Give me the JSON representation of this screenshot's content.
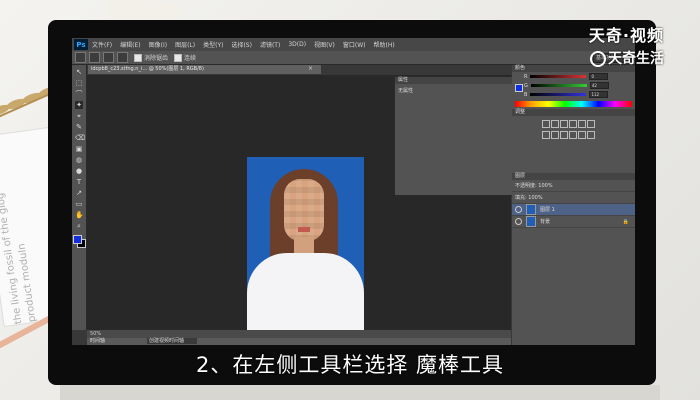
{
  "watermark": {
    "top": "天奇·视频",
    "bottom": "天奇生活"
  },
  "background_text": {
    "book": "the living fossil of the glog\nproduct moduln"
  },
  "photoshop": {
    "logo": "Ps",
    "menu": [
      "文件(F)",
      "编辑(E)",
      "图像(I)",
      "图层(L)",
      "类型(Y)",
      "选择(S)",
      "滤镜(T)",
      "3D(D)",
      "视图(V)",
      "窗口(W)",
      "帮助(H)"
    ],
    "options": {
      "checkbox_1": "消除锯齿",
      "checkbox_2": "连续",
      "right_select": "基本功能"
    },
    "document_tab": "idcpb8_c23.stfng.n_i... @ 50%(图层 1, RGB/8)",
    "tab_close": "×",
    "tools": [
      "↖",
      "⬚",
      "⌒",
      "✦",
      "⌖",
      "✎",
      "⌫",
      "▣",
      "◍",
      "●",
      "T",
      "↗",
      "▭",
      "✋",
      "⌕"
    ],
    "status": "50%",
    "timeline": {
      "label": "时间轴",
      "button": "创建视频时间轴"
    },
    "history": {
      "title": "属性",
      "body": "无属性"
    },
    "color_panel": {
      "title": "颜色",
      "rows": [
        {
          "label": "R",
          "value": "0",
          "bar": "#d33"
        },
        {
          "label": "G",
          "value": "42",
          "bar": "#3c3"
        },
        {
          "label": "B",
          "value": "112",
          "bar": "#33d"
        }
      ]
    },
    "adjustments_title": "调整",
    "layers_panel": {
      "title": "图层",
      "opacity": "不透明度: 100%",
      "fill": "填充: 100%",
      "layers": [
        {
          "name": "图层 1",
          "selected": true
        },
        {
          "name": "背景",
          "selected": false
        }
      ]
    }
  },
  "subtitle": "2、在左侧工具栏选择 魔棒工具",
  "colors": {
    "foreground": "#0f2fe0",
    "photo_bg": "#1f5fb5",
    "ps_panel": "#535353",
    "ps_dark": "#282828"
  }
}
